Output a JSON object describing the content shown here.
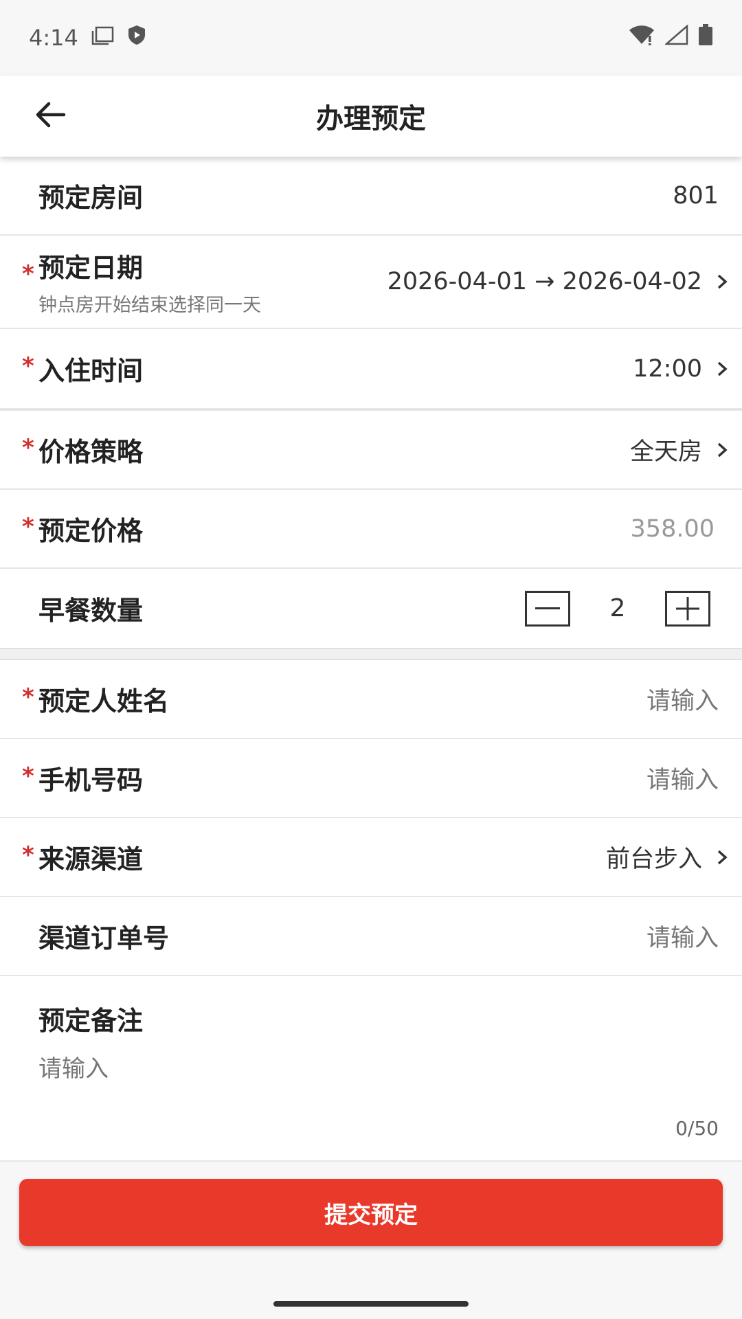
{
  "status_bar": {
    "time": "4:14"
  },
  "app_bar": {
    "title": "办理预定"
  },
  "form": {
    "room": {
      "label": "预定房间",
      "value": "801"
    },
    "date": {
      "label": "预定日期",
      "hint": "钟点房开始结束选择同一天",
      "value": "2026-04-01 → 2026-04-02"
    },
    "checkin_time": {
      "label": "入住时间",
      "value": "12:00"
    },
    "price_policy": {
      "label": "价格策略",
      "value": "全天房"
    },
    "price": {
      "label": "预定价格",
      "value": "358.00"
    },
    "breakfast": {
      "label": "早餐数量",
      "value": "2"
    },
    "guest_name": {
      "label": "预定人姓名",
      "placeholder": "请输入"
    },
    "phone": {
      "label": "手机号码",
      "placeholder": "请输入"
    },
    "channel": {
      "label": "来源渠道",
      "value": "前台步入"
    },
    "channel_order": {
      "label": "渠道订单号",
      "placeholder": "请输入"
    },
    "remark": {
      "label": "预定备注",
      "placeholder": "请输入",
      "counter": "0/50"
    }
  },
  "footer": {
    "submit_label": "提交预定"
  },
  "colors": {
    "accent": "#e8392a",
    "required": "#d32f2f"
  }
}
